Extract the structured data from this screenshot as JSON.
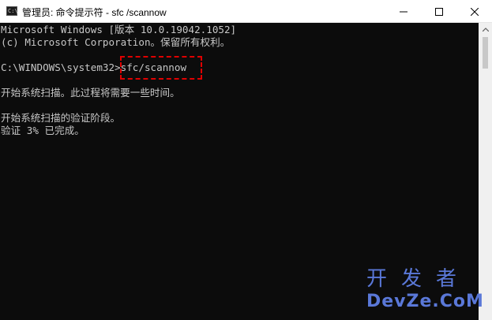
{
  "window": {
    "title": "管理员: 命令提示符 - sfc /scannow",
    "icon_text": "C:\\"
  },
  "console": {
    "lines": [
      "Microsoft Windows [版本 10.0.19042.1052]",
      "(c) Microsoft Corporation。保留所有权利。",
      "",
      "C:\\WINDOWS\\system32>sfc/scannow",
      "",
      "开始系统扫描。此过程将需要一些时间。",
      "",
      "开始系统扫描的验证阶段。",
      "验证 3% 已完成。"
    ],
    "highlighted_command": "sfc/scannow"
  },
  "controls": {
    "minimize_icon": "minimize-icon",
    "maximize_icon": "maximize-icon",
    "close_icon": "close-icon"
  },
  "watermark": {
    "top": "开发者",
    "bottom": "DevZe.CoM"
  },
  "colors": {
    "console_bg": "#0c0c0c",
    "console_text": "#c7c7c7",
    "highlight": "#e00000",
    "watermark": "#5a78d8"
  }
}
